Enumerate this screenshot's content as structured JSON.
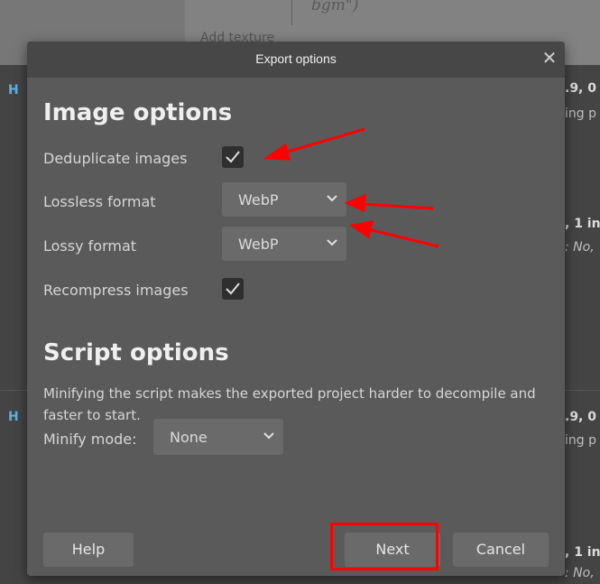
{
  "background": {
    "top_text": "bgm\")",
    "top_text2": "Add texture",
    "fragments": [
      {
        "id": "f1",
        "text": ".9, 0",
        "style": "bold"
      },
      {
        "id": "f2",
        "text": "ing p",
        "style": "normal"
      },
      {
        "id": "f3",
        "text": ", 1 in",
        "style": "bold"
      },
      {
        "id": "f4",
        "text": ": No,",
        "style": "ital"
      },
      {
        "id": "f5",
        "text": ".9, 0",
        "style": "bold"
      },
      {
        "id": "f6",
        "text": "ing p",
        "style": "normal"
      },
      {
        "id": "f7",
        "text": ", 1 in",
        "style": "bold"
      },
      {
        "id": "f8",
        "text": ": No,",
        "style": "ital"
      },
      {
        "id": "f9",
        "text": "H",
        "style": "blue"
      },
      {
        "id": "f10",
        "text": "H",
        "style": "blue"
      }
    ]
  },
  "dialog": {
    "title": "Export options",
    "close_glyph": "✕",
    "image_options": {
      "heading": "Image options",
      "deduplicate_label": "Deduplicate images",
      "deduplicate_checked": true,
      "lossless_label": "Lossless format",
      "lossless_value": "WebP",
      "lossy_label": "Lossy format",
      "lossy_value": "WebP",
      "recompress_label": "Recompress images",
      "recompress_checked": true
    },
    "script_options": {
      "heading": "Script options",
      "description": "Minifying the script makes the exported project harder to decompile and faster to start.",
      "minify_label": "Minify mode:",
      "minify_value": "None"
    },
    "buttons": {
      "help": "Help",
      "next": "Next",
      "cancel": "Cancel"
    }
  },
  "colors": {
    "annotation": "#ff0000",
    "dialog_bg": "#5a5a5a",
    "header_bg": "#474747",
    "control_bg": "#6a6a6a"
  },
  "icons": {
    "close": "close-icon",
    "check": "checkmark-icon",
    "chevron": "chevron-down-icon"
  }
}
